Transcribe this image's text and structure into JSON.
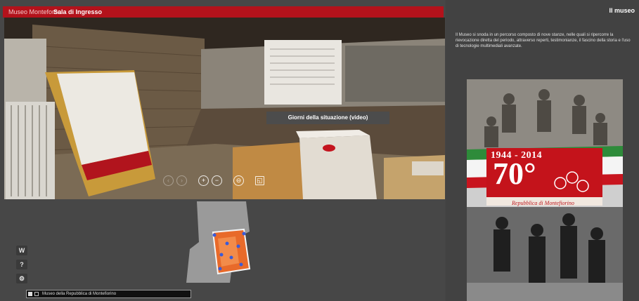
{
  "tour": {
    "museum_label": "Museo Monteforno",
    "room_title": "Sala di Ingresso",
    "hotspot_caption": "Giorni della situazione (video)",
    "nav_icons": [
      "arrow-left-icon",
      "arrow-right-icon",
      "zoom-in-icon",
      "zoom-out-icon",
      "gyro-icon",
      "fullscreen-icon"
    ],
    "nav_glyphs": {
      "left": "‹",
      "right": "›",
      "zoom_in": "+",
      "zoom_out": "−",
      "gyro": "⊖",
      "fullscreen": "◱"
    },
    "side_buttons": {
      "menu": "W",
      "help": "?",
      "settings": "⚙"
    },
    "breadcrumb": "Museo della Repubblica di Montefiorino"
  },
  "info": {
    "title": "Il museo",
    "description": "Il Museo si snoda in un percorso composto di nove stanze, nelle quali si ripercorre la rievocazione diretta del periodo, attraverso reperti, testimonianze, il fascino della storia e l'uso di tecnologie multimediali avanzate.",
    "poster": {
      "years": "1944 - 2014",
      "anniversary": "70°",
      "subtitle": "Repubblica di Montefiorino"
    }
  },
  "colors": {
    "brand_red": "#b3121b",
    "panel_bg": "#424242",
    "viewer_bg": "#474747",
    "map_highlight": "#e86a2a",
    "map_marker": "#3a5bd8"
  }
}
